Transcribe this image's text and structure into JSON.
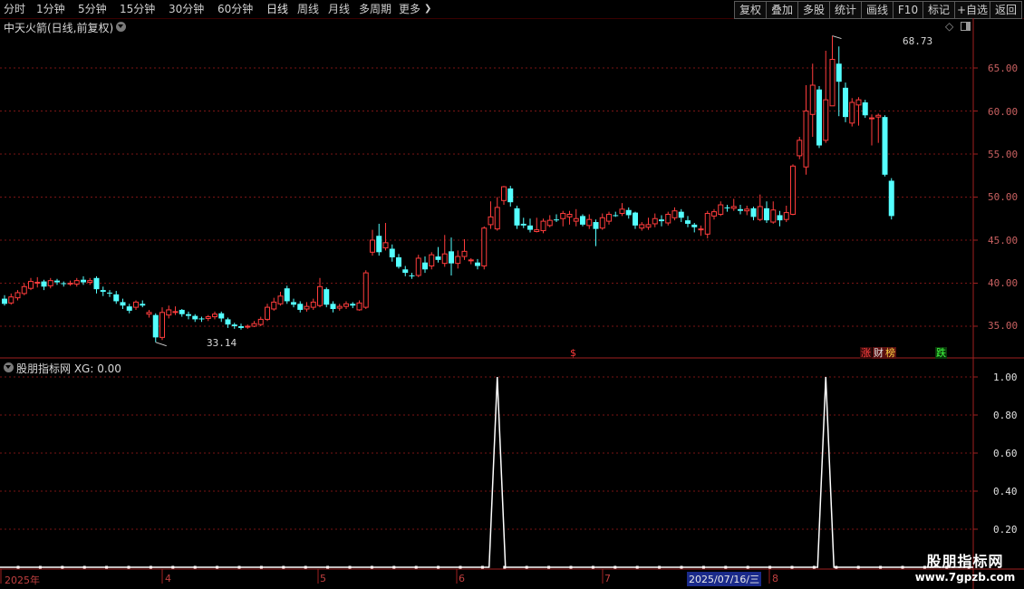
{
  "toolbar": {
    "periods": [
      "分时",
      "1分钟",
      "5分钟",
      "15分钟",
      "30分钟",
      "60分钟",
      "日线",
      "周线",
      "月线",
      "多周期",
      "更多"
    ],
    "active_period": "日线",
    "right_buttons": [
      "复权",
      "叠加",
      "多股",
      "统计",
      "画线",
      "F10",
      "标记",
      "+自选",
      "返回"
    ]
  },
  "main_chart": {
    "title": "中天火箭(日线,前复权)",
    "max_label": "68.73",
    "min_label": "33.14",
    "y_ticks": [
      "65.00",
      "60.00",
      "55.00",
      "50.00",
      "45.00",
      "40.00",
      "35.00"
    ],
    "markers": [
      {
        "text": "$",
        "color": "#ff3b3b",
        "bg": "#000000"
      },
      {
        "text": "涨",
        "color": "#ff4040",
        "bg": "#3a0a0a"
      },
      {
        "text": "财",
        "color": "#e0e0e0",
        "bg": "#5a1010"
      },
      {
        "text": "榜",
        "color": "#ffd040",
        "bg": "#5a1010"
      },
      {
        "text": "跌",
        "color": "#40ff40",
        "bg": "#0a3a0a"
      }
    ]
  },
  "indicator": {
    "title": "股朋指标网 XG: 0.00",
    "y_ticks": [
      "1.00",
      "0.80",
      "0.60",
      "0.40",
      "0.20"
    ]
  },
  "date_axis": {
    "labels": [
      "2025年",
      "4",
      "5",
      "6",
      "7",
      "8"
    ],
    "cursor_date": "2025/07/16/三"
  },
  "watermark": {
    "line1": "股朋指标网",
    "line2": "www.7gpzb.com"
  },
  "chart_data": {
    "type": "candlestick",
    "title": "中天火箭(日线,前复权)",
    "ylim": [
      31.5,
      70
    ],
    "candles": [
      [
        38.2,
        37.6,
        38.6,
        37.4
      ],
      [
        37.7,
        38.4,
        38.8,
        37.5
      ],
      [
        38.3,
        38.9,
        39.2,
        38.0
      ],
      [
        38.8,
        39.6,
        40.0,
        38.6
      ],
      [
        39.4,
        40.2,
        40.6,
        39.2
      ],
      [
        40.0,
        40.1,
        40.7,
        39.5
      ],
      [
        40.2,
        39.6,
        40.4,
        39.2
      ],
      [
        39.7,
        40.3,
        40.6,
        39.4
      ],
      [
        40.3,
        40.1,
        40.5,
        39.8
      ],
      [
        40.0,
        39.9,
        40.2,
        39.6
      ],
      [
        40.0,
        40.0,
        40.3,
        39.7
      ],
      [
        39.9,
        40.3,
        40.6,
        39.6
      ],
      [
        40.4,
        40.1,
        40.8,
        39.8
      ],
      [
        40.1,
        40.3,
        40.6,
        39.8
      ],
      [
        40.6,
        39.3,
        40.8,
        38.8
      ],
      [
        39.2,
        39.0,
        39.6,
        38.5
      ],
      [
        38.9,
        38.8,
        39.2,
        38.4
      ],
      [
        38.7,
        37.9,
        39.1,
        37.6
      ],
      [
        37.8,
        37.4,
        38.2,
        37.0
      ],
      [
        37.3,
        36.8,
        37.6,
        36.5
      ],
      [
        37.2,
        37.8,
        38.0,
        36.9
      ],
      [
        37.6,
        37.4,
        38.0,
        37.2
      ],
      [
        36.4,
        36.6,
        36.9,
        36.0
      ],
      [
        36.3,
        33.7,
        36.5,
        33.14
      ],
      [
        33.7,
        36.6,
        37.2,
        33.4
      ],
      [
        36.3,
        36.9,
        37.4,
        35.9
      ],
      [
        36.6,
        36.7,
        37.3,
        36.3
      ],
      [
        36.9,
        36.4,
        37.0,
        36.1
      ],
      [
        36.4,
        36.2,
        36.7,
        35.8
      ],
      [
        36.2,
        35.8,
        36.4,
        35.5
      ],
      [
        35.9,
        35.8,
        36.1,
        35.5
      ],
      [
        35.9,
        36.1,
        36.3,
        35.6
      ],
      [
        36.1,
        36.4,
        36.7,
        35.8
      ],
      [
        36.5,
        35.9,
        36.7,
        35.5
      ],
      [
        35.8,
        35.2,
        36.0,
        34.8
      ],
      [
        35.2,
        35.0,
        35.4,
        34.7
      ],
      [
        35.0,
        34.8,
        35.3,
        34.6
      ],
      [
        34.9,
        35.0,
        35.2,
        34.7
      ],
      [
        35.0,
        35.3,
        35.6,
        34.9
      ],
      [
        35.2,
        35.8,
        36.1,
        35.0
      ],
      [
        35.8,
        37.2,
        37.6,
        35.6
      ],
      [
        37.0,
        37.8,
        38.3,
        36.8
      ],
      [
        37.6,
        38.5,
        39.0,
        37.4
      ],
      [
        39.4,
        37.9,
        39.7,
        37.6
      ],
      [
        37.8,
        37.5,
        38.2,
        37.2
      ],
      [
        37.6,
        36.9,
        37.9,
        36.6
      ],
      [
        37.0,
        37.3,
        37.8,
        36.7
      ],
      [
        37.2,
        37.8,
        38.2,
        36.9
      ],
      [
        37.4,
        39.6,
        40.6,
        37.2
      ],
      [
        39.3,
        37.5,
        39.5,
        37.2
      ],
      [
        37.6,
        37.0,
        37.9,
        36.6
      ],
      [
        37.1,
        37.3,
        37.6,
        36.8
      ],
      [
        37.3,
        37.6,
        37.9,
        37.0
      ],
      [
        37.6,
        37.4,
        37.8,
        37.1
      ],
      [
        36.9,
        37.7,
        38.0,
        36.8
      ],
      [
        37.2,
        41.2,
        41.5,
        37.0
      ],
      [
        43.6,
        45.0,
        46.2,
        43.2
      ],
      [
        45.5,
        43.6,
        46.9,
        43.2
      ],
      [
        44.1,
        44.7,
        47.0,
        43.8
      ],
      [
        44.0,
        43.0,
        44.5,
        42.5
      ],
      [
        43.0,
        41.9,
        43.4,
        41.7
      ],
      [
        41.6,
        41.2,
        42.0,
        40.8
      ],
      [
        40.9,
        40.8,
        41.2,
        40.5
      ],
      [
        40.9,
        42.9,
        43.3,
        40.7
      ],
      [
        42.4,
        41.6,
        43.1,
        41.2
      ],
      [
        42.0,
        43.3,
        43.6,
        41.6
      ],
      [
        43.1,
        42.7,
        44.2,
        42.4
      ],
      [
        42.3,
        43.4,
        45.6,
        41.9
      ],
      [
        43.7,
        42.3,
        45.3,
        40.9
      ],
      [
        42.3,
        43.1,
        43.8,
        41.7
      ],
      [
        43.1,
        43.7,
        45.1,
        42.7
      ],
      [
        42.7,
        42.7,
        42.9,
        42.2
      ],
      [
        42.4,
        42.0,
        42.8,
        41.6
      ],
      [
        42.0,
        46.4,
        46.6,
        41.6
      ],
      [
        46.8,
        47.7,
        49.5,
        46.3
      ],
      [
        46.3,
        48.8,
        50.0,
        46.1
      ],
      [
        49.6,
        51.2,
        51.3,
        49.1
      ],
      [
        51.0,
        49.4,
        51.3,
        48.9
      ],
      [
        48.7,
        46.7,
        49.0,
        46.3
      ],
      [
        46.9,
        46.7,
        47.6,
        46.4
      ],
      [
        46.7,
        46.2,
        47.5,
        45.9
      ],
      [
        46.0,
        46.2,
        47.6,
        45.9
      ],
      [
        46.1,
        47.2,
        47.5,
        45.8
      ],
      [
        46.7,
        47.3,
        47.9,
        46.5
      ],
      [
        47.4,
        47.3,
        48.0,
        47.1
      ],
      [
        47.5,
        48.1,
        48.4,
        46.6
      ],
      [
        47.7,
        48.0,
        48.4,
        46.8
      ],
      [
        47.2,
        47.5,
        48.6,
        46.6
      ],
      [
        47.8,
        46.8,
        48.0,
        46.6
      ],
      [
        46.7,
        47.4,
        48.0,
        46.3
      ],
      [
        47.1,
        46.3,
        47.4,
        44.3
      ],
      [
        46.4,
        47.6,
        48.1,
        46.2
      ],
      [
        47.2,
        48.0,
        48.3,
        46.8
      ],
      [
        47.9,
        47.8,
        48.3,
        47.7
      ],
      [
        48.1,
        48.6,
        49.3,
        47.8
      ],
      [
        48.5,
        47.9,
        48.8,
        47.5
      ],
      [
        48.2,
        46.7,
        48.3,
        46.3
      ],
      [
        46.4,
        46.8,
        47.1,
        46.1
      ],
      [
        46.5,
        46.8,
        47.6,
        46.2
      ],
      [
        46.9,
        47.5,
        48.1,
        46.5
      ],
      [
        47.4,
        47.2,
        47.9,
        46.6
      ],
      [
        47.0,
        48.0,
        48.3,
        46.7
      ],
      [
        47.6,
        48.4,
        48.8,
        47.3
      ],
      [
        48.3,
        47.6,
        48.6,
        47.1
      ],
      [
        47.3,
        46.9,
        47.8,
        46.5
      ],
      [
        46.8,
        46.5,
        47.0,
        45.9
      ],
      [
        46.2,
        46.3,
        46.7,
        45.5
      ],
      [
        45.7,
        48.1,
        48.4,
        45.2
      ],
      [
        47.8,
        48.3,
        48.6,
        47.4
      ],
      [
        48.0,
        49.1,
        49.5,
        47.8
      ],
      [
        48.8,
        48.7,
        49.1,
        48.3
      ],
      [
        48.7,
        48.9,
        49.8,
        48.4
      ],
      [
        48.6,
        48.4,
        49.1,
        48.0
      ],
      [
        48.4,
        48.6,
        49.0,
        47.9
      ],
      [
        48.7,
        47.7,
        48.9,
        47.3
      ],
      [
        47.4,
        48.9,
        50.3,
        47.2
      ],
      [
        48.7,
        47.3,
        49.5,
        47.0
      ],
      [
        47.1,
        48.5,
        49.5,
        46.9
      ],
      [
        47.9,
        47.3,
        48.4,
        46.6
      ],
      [
        47.4,
        48.2,
        49.0,
        47.1
      ],
      [
        48.0,
        53.6,
        53.8,
        47.9
      ],
      [
        54.8,
        56.6,
        57.0,
        54.4
      ],
      [
        53.5,
        60.0,
        63.0,
        52.6
      ],
      [
        59.6,
        63.0,
        65.5,
        57.0
      ],
      [
        62.5,
        56.0,
        62.9,
        55.7
      ],
      [
        56.6,
        61.3,
        67.0,
        56.3
      ],
      [
        60.6,
        66.0,
        68.73,
        60.6
      ],
      [
        65.5,
        63.4,
        67.5,
        59.4
      ],
      [
        62.7,
        59.3,
        63.3,
        58.7
      ],
      [
        58.6,
        61.0,
        61.5,
        58.2
      ],
      [
        60.7,
        61.3,
        61.6,
        58.3
      ],
      [
        61.0,
        59.5,
        61.3,
        59.2
      ],
      [
        59.2,
        59.2,
        59.6,
        56.0
      ],
      [
        59.3,
        59.5,
        59.7,
        56.3
      ],
      [
        59.3,
        52.6,
        59.5,
        52.4
      ],
      [
        51.9,
        47.8,
        52.2,
        47.4
      ]
    ],
    "xg_signals": [
      {
        "bar_index": 75,
        "value": 1.0
      },
      {
        "bar_index": 125,
        "value": 1.0
      }
    ],
    "xg_ylim": [
      0,
      1.0
    ]
  }
}
